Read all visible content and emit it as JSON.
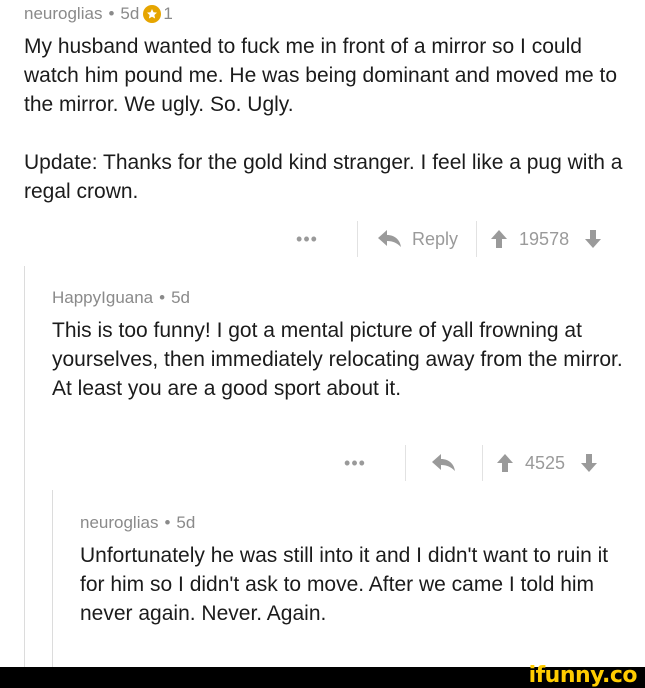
{
  "comments": [
    {
      "author": "neuroglias",
      "separator": "•",
      "age": "5d",
      "gold_count": "1",
      "paragraphs": [
        "My husband wanted to fuck me in front of a mirror so I could watch him pound me. He was being dominant and moved me to the mirror. We ugly. So. Ugly.",
        "Update: Thanks for the gold kind stranger. I feel like a pug with a regal crown."
      ],
      "more_label": "•••",
      "reply_label": "Reply",
      "score": "19578"
    },
    {
      "author": "HappyIguana",
      "separator": "•",
      "age": "5d",
      "paragraphs": [
        "This is too funny! I got a mental picture of yall frowning at yourselves, then immediately relocating away from the mirror. At least you are a good sport about it."
      ],
      "more_label": "•••",
      "score": "4525"
    },
    {
      "author": "neuroglias",
      "separator": "•",
      "age": "5d",
      "paragraphs": [
        "Unfortunately he was still into it and I didn't want to ruin it for him so I didn't ask to move. After we came I told him never again. Never. Again."
      ]
    }
  ],
  "watermark": "ifunny.co",
  "colors": {
    "meta_text": "#8a8a8a",
    "body_text": "#1b1b1b",
    "action_gray": "#9a9a9a",
    "gold": "#e6a500",
    "watermark": "#ffcc00"
  },
  "icons": {
    "gold": "gold-star-icon",
    "reply": "reply-arrow-icon",
    "upvote": "upvote-arrow-icon",
    "downvote": "downvote-arrow-icon"
  }
}
